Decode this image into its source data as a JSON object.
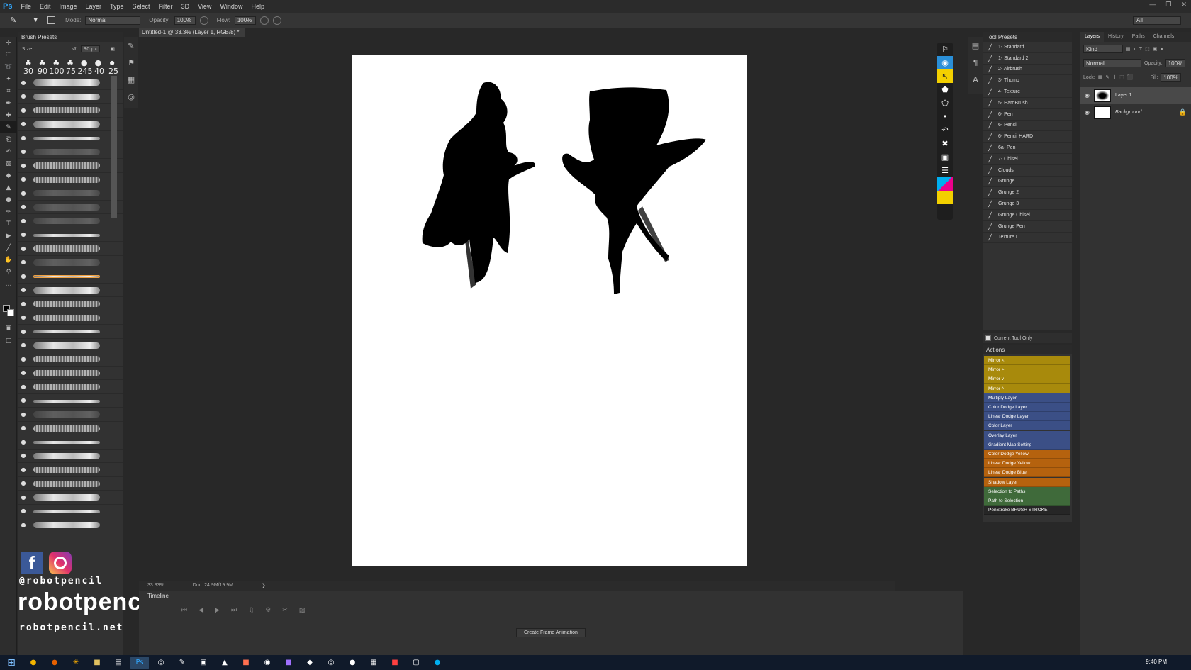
{
  "app": {
    "logo": "Ps"
  },
  "menu": [
    "File",
    "Edit",
    "Image",
    "Layer",
    "Type",
    "Select",
    "Filter",
    "3D",
    "View",
    "Window",
    "Help"
  ],
  "options_bar": {
    "mode_label": "Mode:",
    "mode_value": "Normal",
    "opacity_label": "Opacity:",
    "opacity_value": "100%",
    "flow_label": "Flow:",
    "flow_value": "100%",
    "workspace": "All"
  },
  "brush_presets": {
    "title": "Brush Presets",
    "size_label": "Size:",
    "size_value": "30 px",
    "tip_sizes": [
      "30",
      "90",
      "100",
      "75",
      "245",
      "40",
      "25"
    ]
  },
  "document": {
    "tab_title": "Untitled-1 @ 33.3% (Layer 1, RGB/8) *",
    "zoom": "33.33%",
    "doc_size": "Doc: 24.9M/19.9M"
  },
  "timeline": {
    "title": "Timeline",
    "create_button": "Create Frame Animation"
  },
  "tool_presets": {
    "title": "Tool Presets",
    "items": [
      "1- Standard",
      "1- Standard 2",
      "2- Airbrush",
      "3- Thumb",
      "4- Texture",
      "5- HardBrush",
      "6- Pen",
      "6- Pencil",
      "6- Pencil HARD",
      "6a- Pen",
      "7- Chisel",
      "Clouds",
      "Grunge",
      "Grunge 2",
      "Grunge 3",
      "Grunge Chisel",
      "Grunge Pen",
      "Texture I"
    ],
    "current_tool_only": "Current Tool Only"
  },
  "actions": {
    "title": "Actions",
    "items": [
      {
        "label": "Mirror <",
        "color": "#a88a0c"
      },
      {
        "label": "Mirror >",
        "color": "#a88a0c"
      },
      {
        "label": "Mirror v",
        "color": "#a88a0c"
      },
      {
        "label": "Mirror ^",
        "color": "#a88a0c"
      },
      {
        "label": "Multiply Layer",
        "color": "#3b4f86"
      },
      {
        "label": "Color Dodge Layer",
        "color": "#3b4f86"
      },
      {
        "label": "Linear Dodge Layer",
        "color": "#3b4f86"
      },
      {
        "label": "Color Layer",
        "color": "#3b4f86"
      },
      {
        "label": "Overlay Layer",
        "color": "#3b4f86"
      },
      {
        "label": "Gradient Map Setting",
        "color": "#3b4f86"
      },
      {
        "label": "Color Dodge Yellow",
        "color": "#b5620e"
      },
      {
        "label": "Linear Dodge Yellow",
        "color": "#b5620e"
      },
      {
        "label": "Linear Dodge Blue",
        "color": "#b5620e"
      },
      {
        "label": "Shadow Layer",
        "color": "#b5620e"
      },
      {
        "label": "Selection to Paths",
        "color": "#3f6a3a"
      },
      {
        "label": "Path to Selection",
        "color": "#3f6a3a"
      },
      {
        "label": "PenStroke BRUSH STROKE",
        "color": "#262626"
      }
    ]
  },
  "layers_panel": {
    "tabs": [
      "Layers",
      "History",
      "Paths",
      "Channels"
    ],
    "kind_label": "Kind",
    "blend_mode": "Normal",
    "opacity_label": "Opacity:",
    "opacity_value": "100%",
    "lock_label": "Lock:",
    "fill_label": "Fill:",
    "fill_value": "100%",
    "layers": [
      {
        "name": "Layer 1"
      },
      {
        "name": "Background"
      }
    ]
  },
  "social": {
    "handle": "@robotpencil",
    "brand": "robotpencil",
    "url": "robotpencil.net"
  },
  "taskbar": {
    "clock": "9:40 PM"
  }
}
